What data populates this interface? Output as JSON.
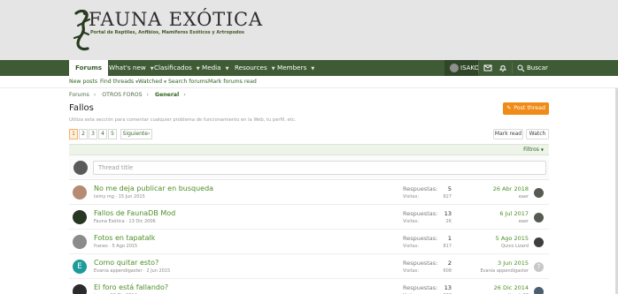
{
  "site": {
    "logo_title": "FAUNA EXÓTICA",
    "logo_subtitle": "Portal de Reptiles, Anfibios, Mamiferos Exóticos y Artropodos"
  },
  "nav": {
    "items": [
      {
        "label": "Forums",
        "active": true
      },
      {
        "label": "What's new"
      },
      {
        "label": "Clasificados"
      },
      {
        "label": "Media"
      },
      {
        "label": "Resources"
      },
      {
        "label": "Members"
      }
    ],
    "user": "ISAKO",
    "search": "Buscar"
  },
  "subnav": {
    "items": [
      "New posts",
      "Find threads",
      "Watched",
      "Search forums",
      "Mark forums read"
    ]
  },
  "breadcrumbs": [
    "Forums",
    "OTROS FOROS",
    "General"
  ],
  "page": {
    "title": "Fallos",
    "description": "Utiliza esta sección para comentar cualquier problema de funcionamiento en la Web, tu perfil, etc.",
    "post_thread_label": "Post thread"
  },
  "pagination": {
    "pages": [
      "1",
      "2",
      "3",
      "4",
      "5"
    ],
    "current": "1",
    "next_label": "Siguiente"
  },
  "actions": {
    "mark_read": "Mark read",
    "watch": "Watch",
    "filters": "Filtros"
  },
  "composer": {
    "placeholder": "Thread title"
  },
  "threads": [
    {
      "title": "No me deja publicar en busqueda",
      "author": "Isimy mg",
      "date": "15 Jun 2015",
      "replies_label": "Respuestas:",
      "replies": "5",
      "views_label": "Visitas:",
      "views": "827",
      "last_date": "26 Abr 2018",
      "last_user": "eaer",
      "avatar_color": "#b68b73",
      "last_avatar_color": "#565b52"
    },
    {
      "title": "Fallos de FaunaDB Mod",
      "author": "Fauna Exótica",
      "date": "13 Dic 2006",
      "replies_label": "Respuestas:",
      "replies": "13",
      "views_label": "Visitas:",
      "views": "2K",
      "last_date": "6 Jul 2017",
      "last_user": "eaer",
      "avatar_color": "#273724",
      "last_avatar_color": "#565b52"
    },
    {
      "title": "Fotos en tapatalk",
      "author": "franes",
      "date": "5 Ago 2015",
      "replies_label": "Respuestas:",
      "replies": "1",
      "views_label": "Visitas:",
      "views": "817",
      "last_date": "5 Ago 2015",
      "last_user": "Quico Lizard",
      "avatar_color": "#8b8b8b",
      "last_avatar_color": "#3f3f3f"
    },
    {
      "title": "Como quitar esto?",
      "author": "Evania appendigaster",
      "date": "2 Jun 2015",
      "replies_label": "Respuestas:",
      "replies": "2",
      "views_label": "Visitas:",
      "views": "608",
      "last_date": "3 Jun 2015",
      "last_user": "Evania appendigaster",
      "avatar_color": "#1d9b9a",
      "avatar_initial": "E",
      "last_avatar_color": "#c8c8c8",
      "last_avatar_initial": "?"
    },
    {
      "title": "El foro está fallando?",
      "author": "jenny",
      "date": "26 Dic 2014",
      "replies_label": "Respuestas:",
      "replies": "13",
      "views_label": "Visitas:",
      "views": "828",
      "last_date": "26 Dic 2014",
      "last_user": "mikendo97",
      "avatar_color": "#2b2b2b",
      "last_avatar_color": "#4a5e70"
    }
  ]
}
